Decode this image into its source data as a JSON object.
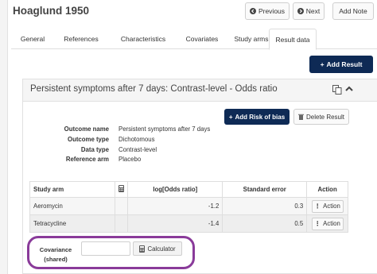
{
  "header": {
    "title": "Hoaglund 1950",
    "previous_label": "Previous",
    "next_label": "Next",
    "add_note_label": "Add Note"
  },
  "tabs": [
    {
      "label": "General"
    },
    {
      "label": "References"
    },
    {
      "label": "Characteristics"
    },
    {
      "label": "Covariates"
    },
    {
      "label": "Study arms"
    },
    {
      "label": "Result data"
    }
  ],
  "active_tab": "Result data",
  "add_result_label": "Add Result",
  "panel": {
    "title": "Persistent symptoms after 7 days: Contrast-level - Odds ratio",
    "add_rob_label": "Add Risk of bias",
    "delete_label": "Delete Result",
    "meta": [
      {
        "label": "Outcome name",
        "value": "Persistent symptoms after 7 days"
      },
      {
        "label": "Outcome type",
        "value": "Dichotomous"
      },
      {
        "label": "Data type",
        "value": "Contrast-level"
      },
      {
        "label": "Reference arm",
        "value": "Placebo"
      }
    ],
    "table": {
      "headers": [
        "Study arm",
        "log[Odds ratio]",
        "Standard error",
        "Action"
      ],
      "rows": [
        {
          "arm": "Aeromycin",
          "log_or": "-1.2",
          "se": "0.3",
          "action": "Action"
        },
        {
          "arm": "Tetracycline",
          "log_or": "-1.4",
          "se": "0.5",
          "action": "Action"
        }
      ]
    },
    "covariance": {
      "label_line1": "Covariance",
      "label_line2": "(shared)",
      "value": "",
      "calculator_label": "Calculator"
    }
  },
  "colors": {
    "primary": "#0e2a55",
    "highlight": "#8a3b9a"
  }
}
